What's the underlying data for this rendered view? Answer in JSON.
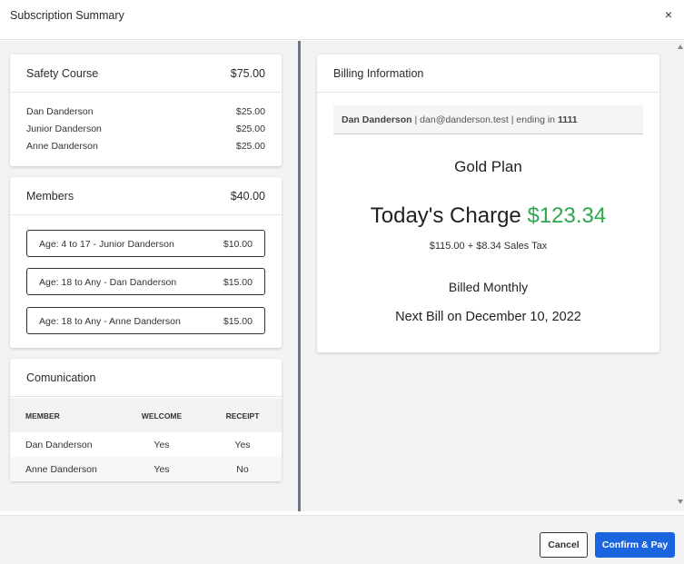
{
  "dialog": {
    "title": "Subscription Summary",
    "close_glyph": "×"
  },
  "safety_course": {
    "title": "Safety Course",
    "total": "$75.00",
    "items": [
      {
        "name": "Dan Danderson",
        "price": "$25.00"
      },
      {
        "name": "Junior Danderson",
        "price": "$25.00"
      },
      {
        "name": "Anne Danderson",
        "price": "$25.00"
      }
    ]
  },
  "members": {
    "title": "Members",
    "total": "$40.00",
    "items": [
      {
        "label": "Age: 4 to 17 - Junior Danderson",
        "price": "$10.00"
      },
      {
        "label": "Age: 18 to Any - Dan Danderson",
        "price": "$15.00"
      },
      {
        "label": "Age: 18 to Any - Anne Danderson",
        "price": "$15.00"
      }
    ]
  },
  "communication": {
    "title": "Comunication",
    "columns": [
      "MEMBER",
      "WELCOME",
      "RECEIPT"
    ],
    "rows": [
      [
        "Dan Danderson",
        "Yes",
        "Yes"
      ],
      [
        "Anne Danderson",
        "Yes",
        "No"
      ]
    ]
  },
  "billing": {
    "title": "Billing Information",
    "customer_name": "Dan Danderson",
    "customer_email": "dan@danderson.test",
    "ending_label": "ending in",
    "card_last4": "1111",
    "plan": "Gold Plan",
    "charge_label": "Today's Charge",
    "charge_amount": "$123.34",
    "tax_breakdown": "$115.00 + $8.34 Sales Tax",
    "frequency": "Billed Monthly",
    "next_bill": "Next Bill on December 10, 2022"
  },
  "footer": {
    "cancel_label": "Cancel",
    "confirm_label": "Confirm & Pay"
  },
  "colors": {
    "accent": "#1b64e0",
    "charge_green": "#2ea84d",
    "divider": "#6e7686"
  },
  "icons": {
    "close": "close-icon",
    "scroll_up": "scroll-up-arrow-icon",
    "scroll_down": "scroll-down-arrow-icon"
  }
}
